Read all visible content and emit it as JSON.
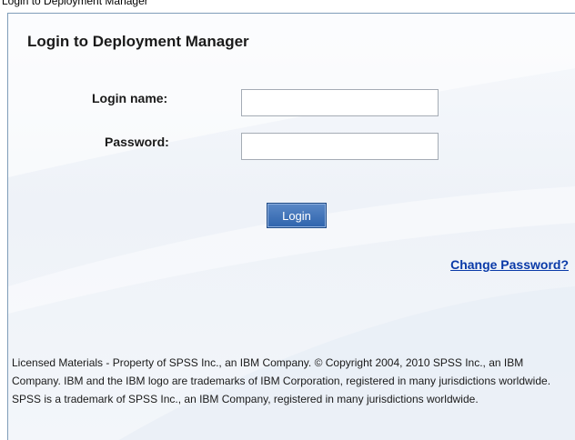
{
  "header_fragment": "Login to Deployment Manager",
  "login": {
    "title": "Login to Deployment Manager",
    "username_label": "Login name:",
    "username_value": "",
    "password_label": "Password:",
    "password_value": "",
    "login_button": "Login",
    "change_password_link": "Change Password?"
  },
  "footer": {
    "license_text": "Licensed Materials - Property of SPSS Inc., an IBM Company. © Copyright 2004, 2010 SPSS Inc., an IBM Company. IBM and the IBM logo are trademarks of IBM Corporation, registered in many jurisdictions worldwide. SPSS is a trademark of SPSS Inc., an IBM Company, registered in many jurisdictions worldwide."
  },
  "colors": {
    "link": "#0a3aa8",
    "button": "#2f64ad",
    "panel_border": "#7f9db9"
  }
}
